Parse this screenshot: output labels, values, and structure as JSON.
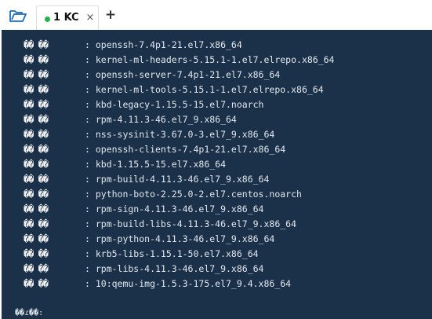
{
  "tabbar": {
    "open_icon": "folder-open-icon",
    "tab": {
      "label": "1 KC",
      "status_color": "#24b34b",
      "close_glyph": "×"
    },
    "new_tab_glyph": "+"
  },
  "terminal": {
    "background": "#1a3149",
    "lines": [
      {
        "prefix": "�� ��",
        "text": ": openssh-7.4p1-21.el7.x86_64"
      },
      {
        "prefix": "�� ��",
        "text": ": kernel-ml-headers-5.15.1-1.el7.elrepo.x86_64"
      },
      {
        "prefix": "�� ��",
        "text": ": openssh-server-7.4p1-21.el7.x86_64"
      },
      {
        "prefix": "�� ��",
        "text": ": kernel-ml-tools-5.15.1-1.el7.elrepo.x86_64"
      },
      {
        "prefix": "�� ��",
        "text": ": kbd-legacy-1.15.5-15.el7.noarch"
      },
      {
        "prefix": "�� ��",
        "text": ": rpm-4.11.3-46.el7_9.x86_64"
      },
      {
        "prefix": "�� ��",
        "text": ": nss-sysinit-3.67.0-3.el7_9.x86_64"
      },
      {
        "prefix": "�� ��",
        "text": ": openssh-clients-7.4p1-21.el7.x86_64"
      },
      {
        "prefix": "�� ��",
        "text": ": kbd-1.15.5-15.el7.x86_64"
      },
      {
        "prefix": "�� ��",
        "text": ": rpm-build-4.11.3-46.el7_9.x86_64"
      },
      {
        "prefix": "�� ��",
        "text": ": python-boto-2.25.0-2.el7.centos.noarch"
      },
      {
        "prefix": "�� ��",
        "text": ": rpm-sign-4.11.3-46.el7_9.x86_64"
      },
      {
        "prefix": "�� ��",
        "text": ": rpm-build-libs-4.11.3-46.el7_9.x86_64"
      },
      {
        "prefix": "�� ��",
        "text": ": rpm-python-4.11.3-46.el7_9.x86_64"
      },
      {
        "prefix": "�� ��",
        "text": ": krb5-libs-1.15.1-50.el7.x86_64"
      },
      {
        "prefix": "�� ��",
        "text": ": rpm-libs-4.11.3-46.el7_9.x86_64"
      },
      {
        "prefix": "�� ��",
        "text": ": 10:qemu-img-1.5.3-175.el7_9.4.x86_64"
      }
    ],
    "prompt": "��ɾ��:"
  }
}
